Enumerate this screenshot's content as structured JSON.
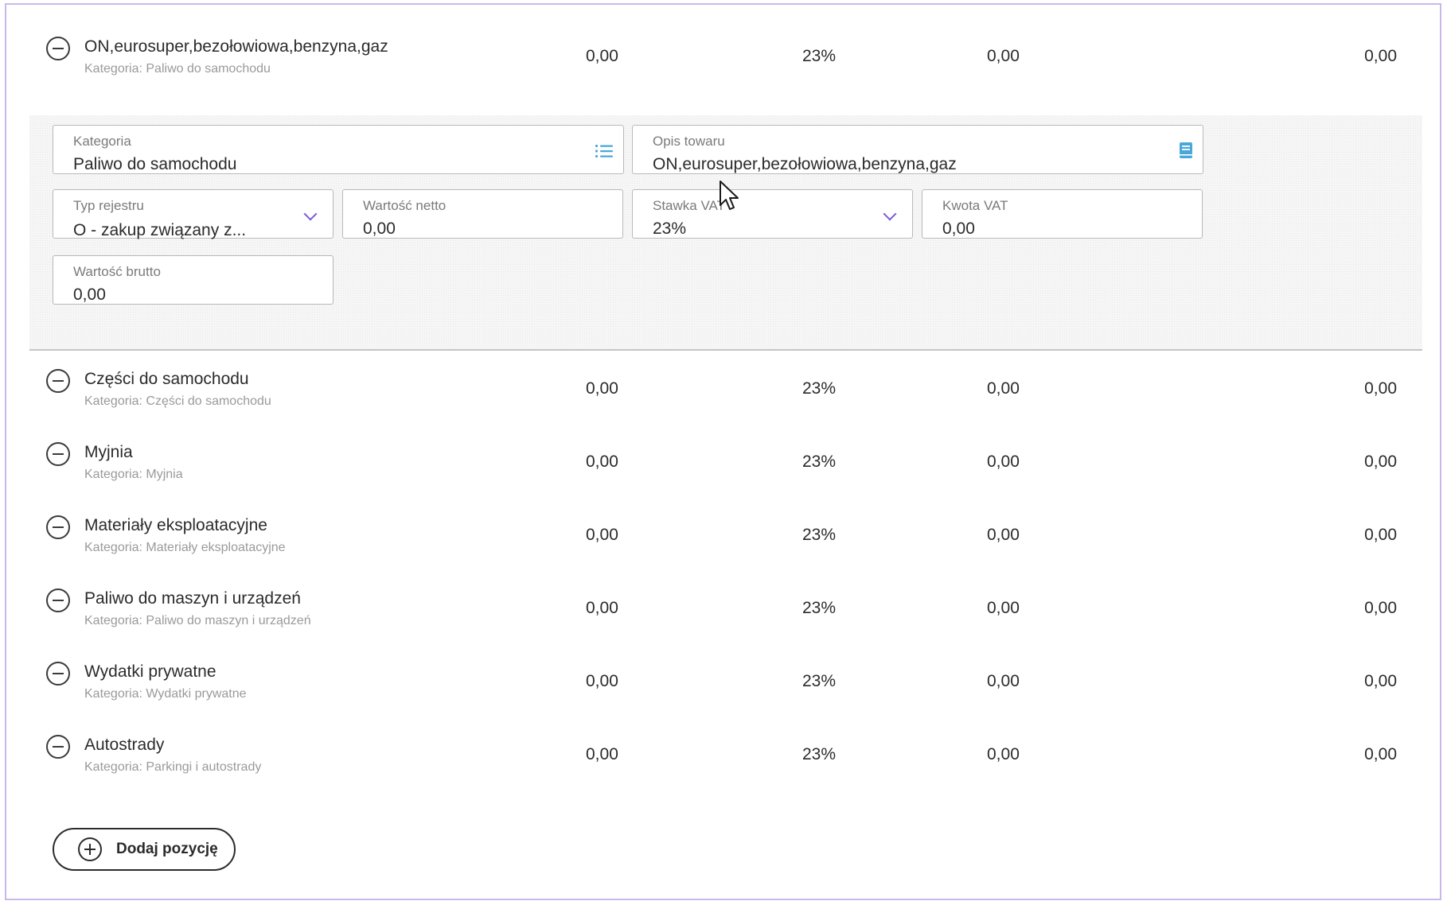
{
  "rows": [
    {
      "name": "ON,eurosuper,bezołowiowa,benzyna,gaz",
      "category": "Kategoria: Paliwo do samochodu",
      "net": "0,00",
      "vat_rate": "23%",
      "vat_amount": "0,00",
      "gross": "0,00"
    },
    {
      "name": "Części do samochodu",
      "category": "Kategoria: Części do samochodu",
      "net": "0,00",
      "vat_rate": "23%",
      "vat_amount": "0,00",
      "gross": "0,00"
    },
    {
      "name": "Myjnia",
      "category": "Kategoria: Myjnia",
      "net": "0,00",
      "vat_rate": "23%",
      "vat_amount": "0,00",
      "gross": "0,00"
    },
    {
      "name": "Materiały eksploatacyjne",
      "category": "Kategoria: Materiały eksploatacyjne",
      "net": "0,00",
      "vat_rate": "23%",
      "vat_amount": "0,00",
      "gross": "0,00"
    },
    {
      "name": "Paliwo do maszyn i urządzeń",
      "category": "Kategoria: Paliwo do maszyn i urządzeń",
      "net": "0,00",
      "vat_rate": "23%",
      "vat_amount": "0,00",
      "gross": "0,00"
    },
    {
      "name": "Wydatki prywatne",
      "category": "Kategoria: Wydatki prywatne",
      "net": "0,00",
      "vat_rate": "23%",
      "vat_amount": "0,00",
      "gross": "0,00"
    },
    {
      "name": "Autostrady",
      "category": "Kategoria: Parkingi i autostrady",
      "net": "0,00",
      "vat_rate": "23%",
      "vat_amount": "0,00",
      "gross": "0,00"
    }
  ],
  "editor": {
    "kategoria": {
      "label": "Kategoria",
      "value": "Paliwo do samochodu",
      "icon": "list-icon"
    },
    "opis_towaru": {
      "label": "Opis towaru",
      "value": "ON,eurosuper,bezołowiowa,benzyna,gaz",
      "icon": "book-icon"
    },
    "typ_rejestru": {
      "label": "Typ rejestru",
      "value": "O - zakup związany z..."
    },
    "wartosc_netto": {
      "label": "Wartość netto",
      "value": "0,00"
    },
    "stawka_vat": {
      "label": "Stawka VAT",
      "value": "23%"
    },
    "kwota_vat": {
      "label": "Kwota VAT",
      "value": "0,00"
    },
    "wartosc_brutto": {
      "label": "Wartość brutto",
      "value": "0,00"
    }
  },
  "add_button": {
    "label": "Dodaj pozycję",
    "icon": "plus-circle-icon"
  },
  "colors": {
    "accent": "#7a5cd6",
    "icon_blue": "#4aa8d8",
    "frame_border": "#c9b8ea"
  }
}
